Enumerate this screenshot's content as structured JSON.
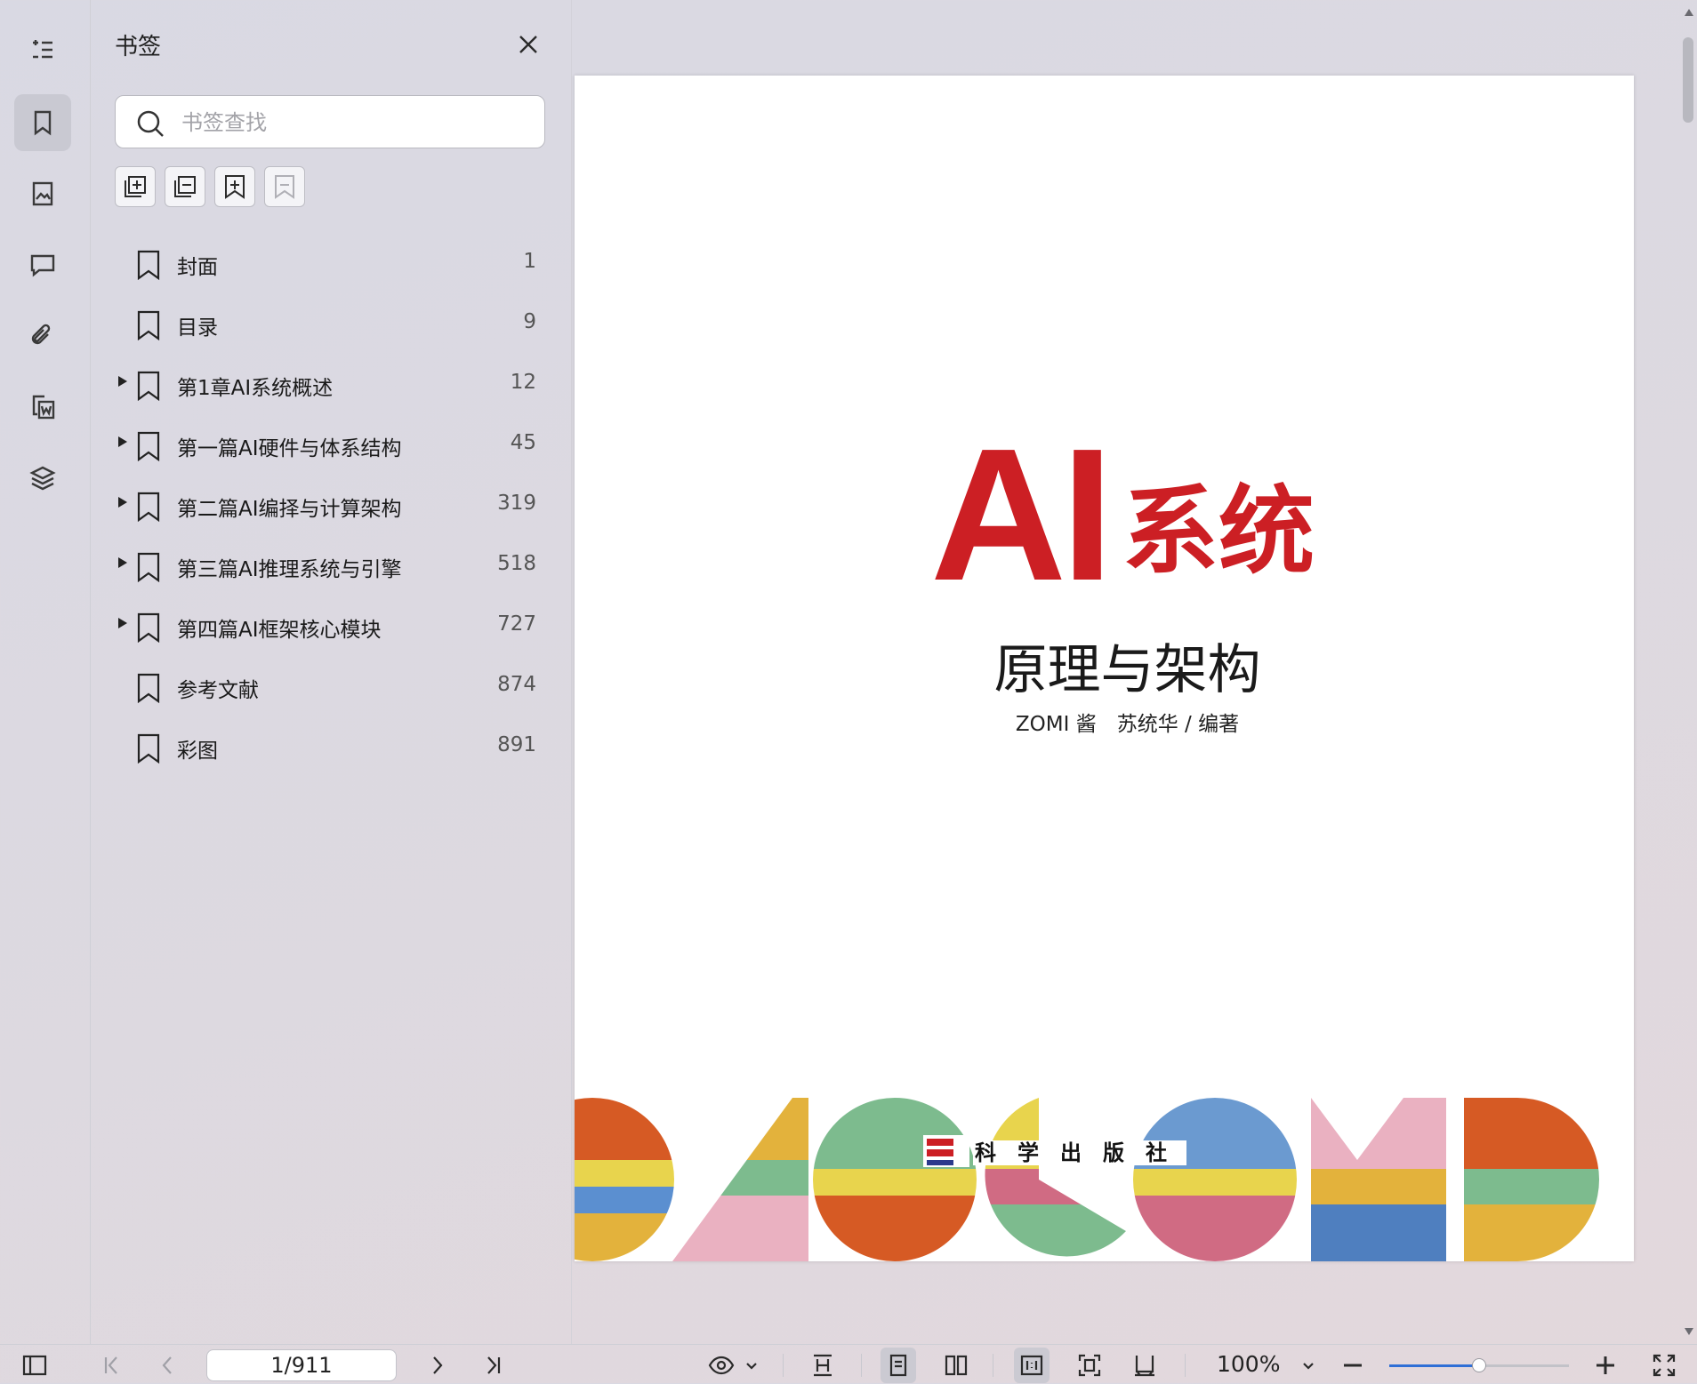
{
  "rail": {
    "items": [
      "outline-icon",
      "bookmark-icon",
      "thumbnail-icon",
      "comment-icon",
      "attachment-icon",
      "signature-icon",
      "layers-icon"
    ],
    "active": "bookmark-icon"
  },
  "panel": {
    "title": "书签",
    "search_placeholder": "书签查找",
    "tools": [
      "expand-all-icon",
      "collapse-all-icon",
      "add-bookmark-icon",
      "delete-bookmark-icon"
    ],
    "bookmarks": [
      {
        "label": "封面",
        "page": "1",
        "expandable": false
      },
      {
        "label": "目录",
        "page": "9",
        "expandable": false
      },
      {
        "label": "第1章AI系统概述",
        "page": "12",
        "expandable": true
      },
      {
        "label": "第一篇AI硬件与体系结构",
        "page": "45",
        "expandable": true
      },
      {
        "label": "第二篇AI编择与计算架构",
        "page": "319",
        "expandable": true
      },
      {
        "label": "第三篇AI推理系统与引擎",
        "page": "518",
        "expandable": true
      },
      {
        "label": "第四篇AI框架核心模块",
        "page": "727",
        "expandable": true
      },
      {
        "label": "参考文献",
        "page": "874",
        "expandable": false
      },
      {
        "label": "彩图",
        "page": "891",
        "expandable": false
      }
    ]
  },
  "cover": {
    "title_latin": "AI",
    "title_cjk": "系统",
    "subtitle": "原理与架构",
    "authors": "ZOMI 酱　苏统华 / 编著",
    "publisher": "科　学　出　版　社",
    "title_color": "#cc1f24"
  },
  "bottombar": {
    "page_indicator": "1/911",
    "zoom": "100%",
    "zoom_fraction": 0.5
  }
}
